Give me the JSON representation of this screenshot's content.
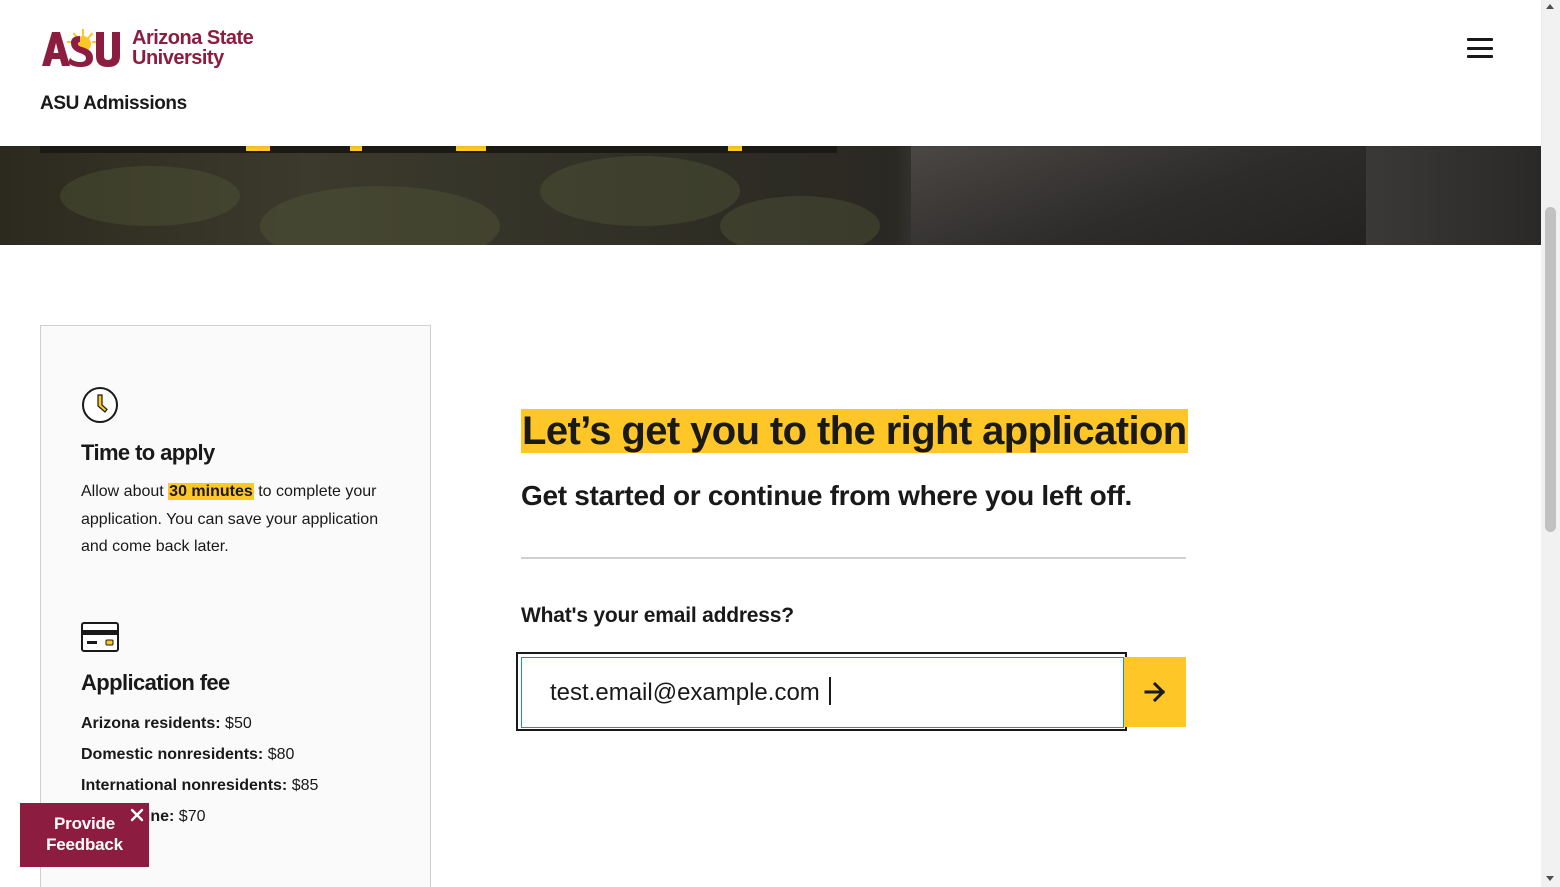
{
  "brand": {
    "logo_mark_text": "ASU",
    "logo_line1": "Arizona State",
    "logo_line2": "University",
    "site_title": "ASU Admissions",
    "maroon": "#8c1d40",
    "gold": "#ffc627"
  },
  "header": {
    "menu_icon": "hamburger-menu-icon"
  },
  "info_card": {
    "time": {
      "icon": "clock-icon",
      "title": "Time to apply",
      "text_before": "Allow about",
      "highlight": "30 minutes",
      "text_after": "to complete your application. You can save your application and come back later."
    },
    "fee": {
      "icon": "credit-card-icon",
      "title": "Application fee",
      "lines": [
        {
          "label": "Arizona residents:",
          "value": "$50"
        },
        {
          "label": "Domestic nonresidents:",
          "value": "$80"
        },
        {
          "label": "International nonresidents:",
          "value": "$85"
        },
        {
          "label": "ASU Online:",
          "value": "$70"
        }
      ]
    }
  },
  "main": {
    "title": "Let’s get you to the right application",
    "subtitle": "Get started or continue from where you left off.",
    "email_label": "What's your email address?",
    "email_value": "test.email@example.com",
    "submit_icon": "arrow-right-icon"
  },
  "feedback": {
    "line1": "Provide",
    "line2": "Feedback",
    "close_icon": "close-icon"
  }
}
